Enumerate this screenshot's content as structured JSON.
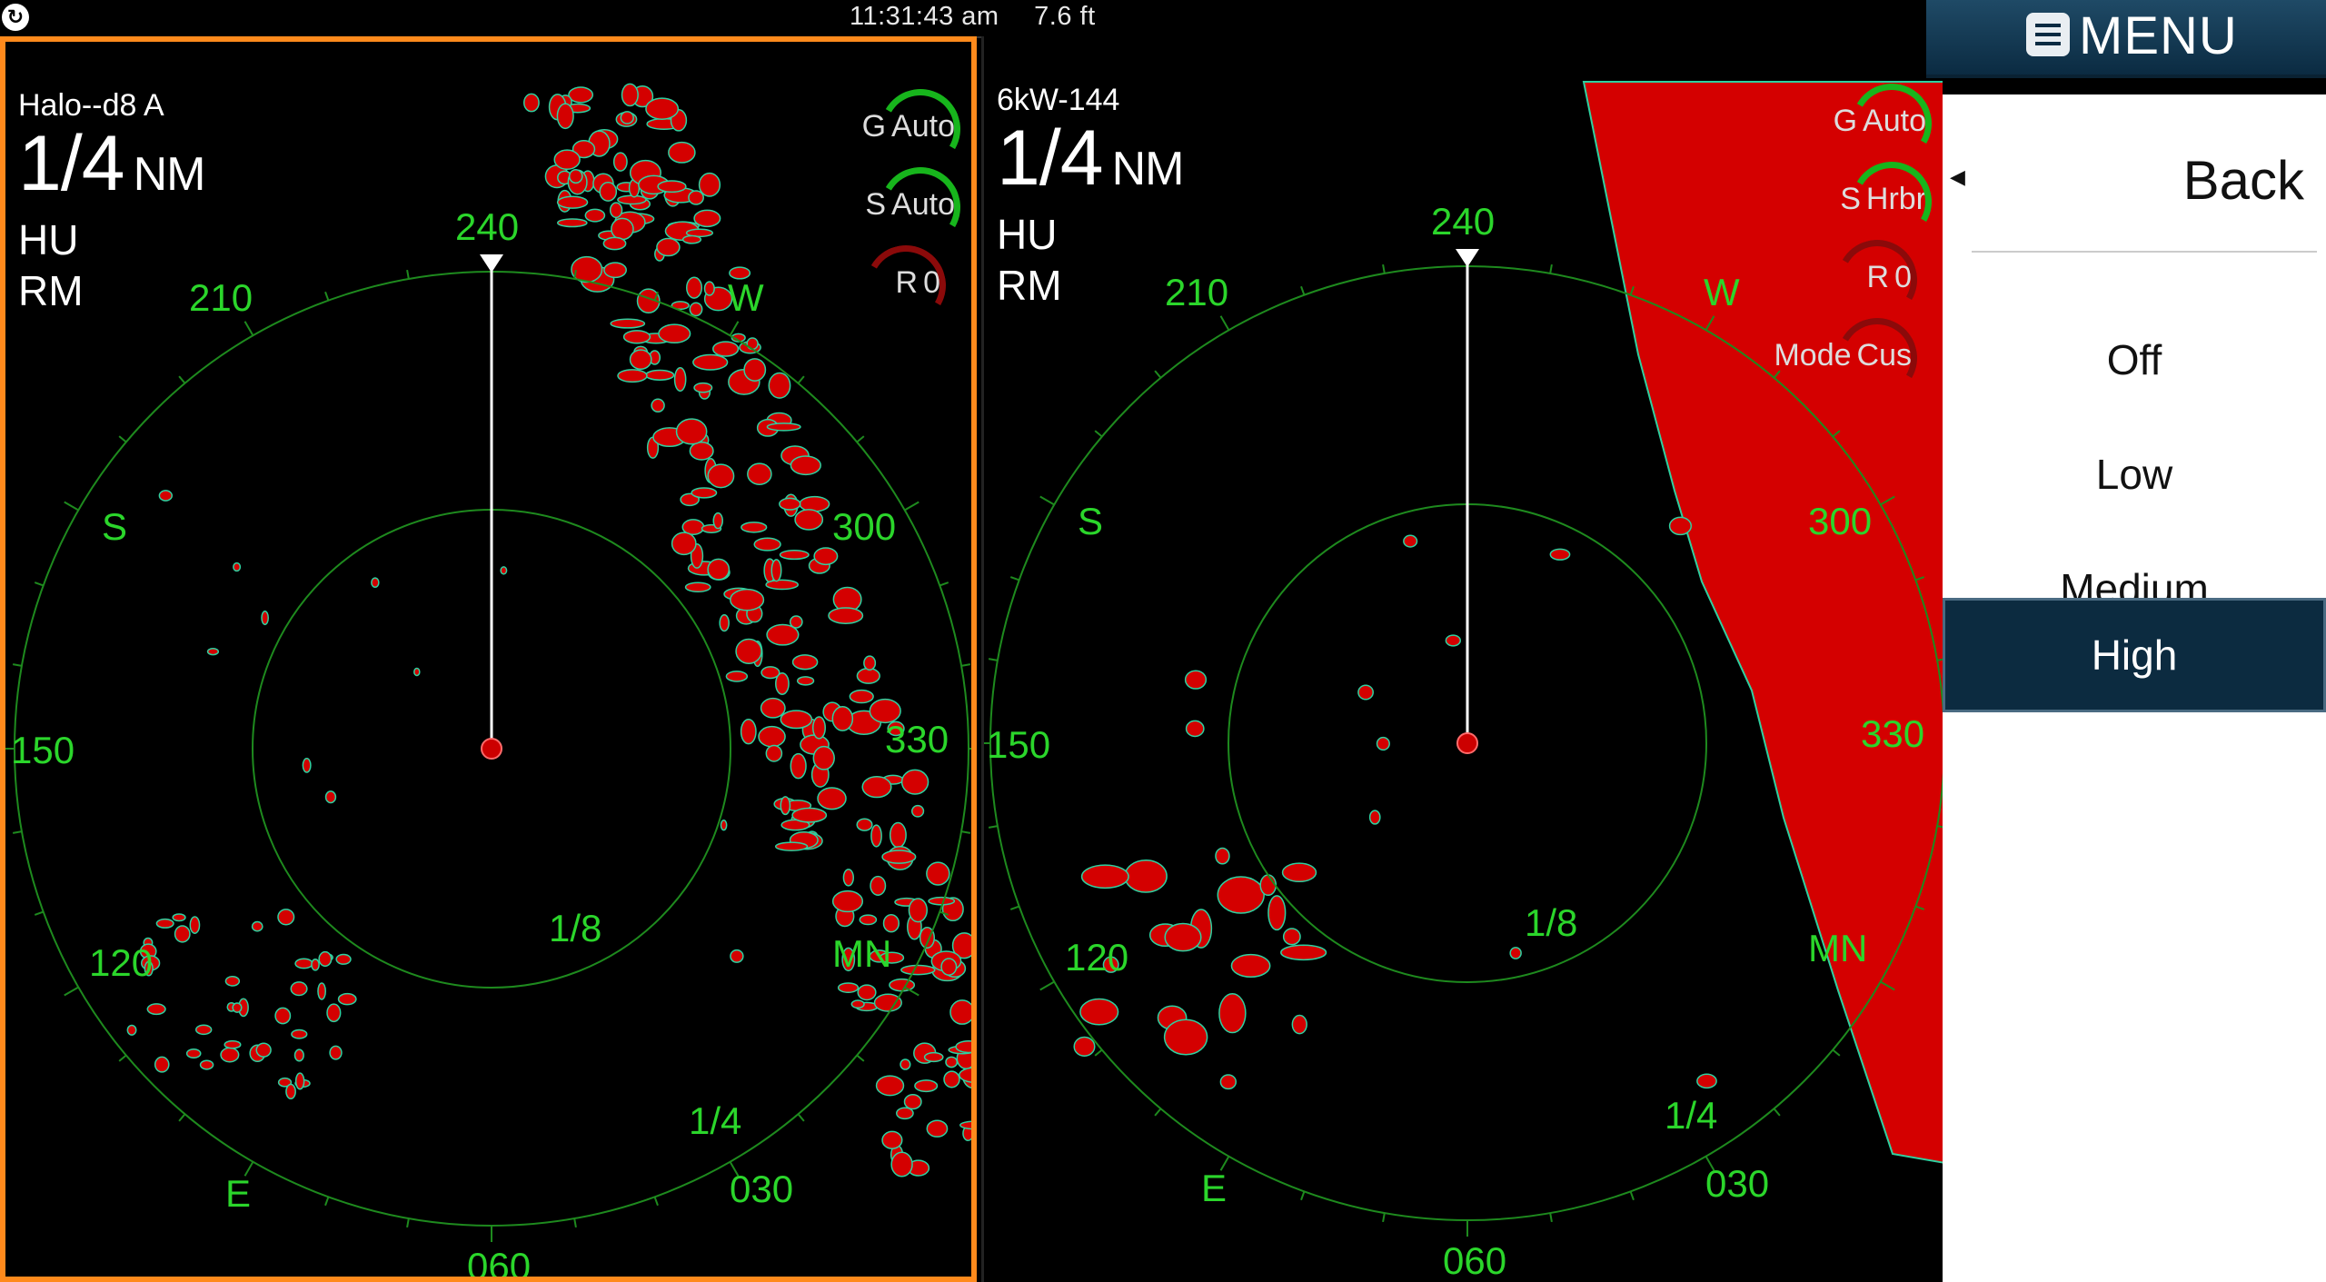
{
  "status_bar": {
    "time": "11:31:43 am",
    "depth": "7.6 ft"
  },
  "radars": [
    {
      "name": "Halo--d8 A",
      "range": "1/4",
      "range_unit": "NM",
      "orientation": "HU",
      "motion": "RM",
      "controls": [
        {
          "key": "G",
          "value": "Auto"
        },
        {
          "key": "S",
          "value": "Auto"
        },
        {
          "key": "R",
          "value": "0"
        }
      ],
      "bearing_labels": [
        "240",
        "210",
        "W",
        "300",
        "S",
        "330",
        "150",
        "120",
        "MN",
        "030",
        "E",
        "060"
      ],
      "ring_labels": [
        "1/8",
        "1/4"
      ]
    },
    {
      "name": "6kW-144",
      "range": "1/4",
      "range_unit": "NM",
      "orientation": "HU",
      "motion": "RM",
      "controls": [
        {
          "key": "G",
          "value": "Auto"
        },
        {
          "key": "S",
          "value": "Hrbr"
        },
        {
          "key": "R",
          "value": "0"
        },
        {
          "key": "Mode",
          "value": "Cus"
        }
      ],
      "bearing_labels": [
        "240",
        "210",
        "W",
        "300",
        "S",
        "330",
        "150",
        "120",
        "MN",
        "030",
        "E",
        "060"
      ],
      "ring_labels": [
        "1/8",
        "1/4"
      ]
    }
  ],
  "menu": {
    "title": "MENU",
    "back_label": "Back",
    "options": [
      "Off",
      "Low",
      "Medium",
      "High"
    ],
    "selected": "High"
  },
  "colors": {
    "echo": "#d40000",
    "ring": "#1e8a1e",
    "label": "#2bd62b",
    "accent": "#ff8a1c",
    "menu_selected": "#0c2b40"
  }
}
